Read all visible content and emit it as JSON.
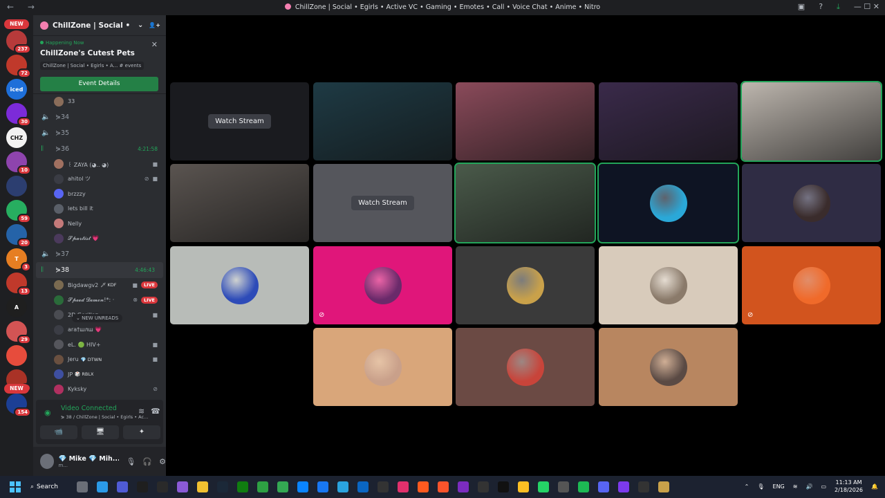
{
  "window": {
    "title": "ChillZone | Social • Egirls • Active VC • Gaming • Emotes • Call • Voice Chat • Anime • Nitro",
    "nav": "← →",
    "controls": "—  ☐  ✕"
  },
  "servers": {
    "new_top": "NEW",
    "new_bottom": "NEW",
    "items": [
      {
        "badge": "237",
        "color": "#b73a3a",
        "label": ""
      },
      {
        "badge": "72",
        "color": "#c0392b",
        "label": ""
      },
      {
        "badge": "",
        "color": "#1e6fd9",
        "label": "iced"
      },
      {
        "badge": "30",
        "color": "#7c2bd9",
        "label": ""
      },
      {
        "badge": "",
        "color": "#f2f2f2",
        "label": "CHZ"
      },
      {
        "badge": "10",
        "color": "#8e44ad",
        "label": ""
      },
      {
        "badge": "",
        "color": "#2c3e70",
        "label": ""
      },
      {
        "badge": "59",
        "color": "#27ae60",
        "label": ""
      },
      {
        "badge": "20",
        "color": "#2563a8",
        "label": ""
      },
      {
        "badge": "3",
        "color": "#e67e22",
        "label": "T"
      },
      {
        "badge": "13",
        "color": "#c0392b",
        "label": ""
      },
      {
        "badge": "",
        "color": "#1f1f1f",
        "label": "A"
      },
      {
        "badge": "29",
        "color": "#d35454",
        "label": ""
      },
      {
        "badge": "",
        "color": "#e74c3c",
        "label": ""
      },
      {
        "badge": "3",
        "color": "#a93226",
        "label": ""
      },
      {
        "badge": "154",
        "color": "#1c3f95",
        "label": ""
      }
    ]
  },
  "guild": {
    "name": "ChillZone | Social • Egi...",
    "chevron": "⌄",
    "invite_icon": "👤+"
  },
  "event": {
    "status": "Happening Now",
    "name": "ChillZone's Cutest Pets",
    "location": "ChillZone | Social • Egirls • A...  # events",
    "button": "Event Details",
    "close": "✕"
  },
  "channels": [
    {
      "kind": "member",
      "name": "33",
      "avatar": "#8a6d5a",
      "tags": [],
      "icons": []
    },
    {
      "kind": "voice",
      "name": "34",
      "active": false,
      "time": ""
    },
    {
      "kind": "voice",
      "name": "35",
      "active": false,
      "time": ""
    },
    {
      "kind": "voice",
      "name": "36",
      "active": false,
      "time": "4:21:58",
      "live_icon": true
    },
    {
      "kind": "member",
      "name": "꒰ ZAYA (◕.. ◕)",
      "avatar": "#a07060",
      "tags": [],
      "icons": [
        "cam"
      ]
    },
    {
      "kind": "member",
      "name": "ahitol ツ",
      "avatar": "#3a3c44",
      "tags": [],
      "icons": [
        "mute",
        "cam"
      ]
    },
    {
      "kind": "member",
      "name": "brzzzy",
      "avatar": "#5865f2",
      "tags": [],
      "icons": []
    },
    {
      "kind": "member",
      "name": "lets bill it",
      "avatar": "#5a5f68",
      "tags": [],
      "icons": []
    },
    {
      "kind": "member",
      "name": "Nelly",
      "avatar": "#c47a7a",
      "tags": [],
      "icons": []
    },
    {
      "kind": "member",
      "name": "𝓢𝓹𝓪𝓻𝓽𝓲𝓼𝓽 💗",
      "avatar": "#4b3a5c",
      "tags": [],
      "icons": []
    },
    {
      "kind": "voice",
      "name": "37",
      "active": false,
      "time": ""
    },
    {
      "kind": "voice",
      "name": "38",
      "active": true,
      "time": "4:46:43",
      "live_icon": true
    },
    {
      "kind": "member",
      "name": "Bigdawgv2",
      "avatar": "#7a6a50",
      "tags": [
        "🗡 KDF"
      ],
      "icons": [
        "cam",
        "live"
      ]
    },
    {
      "kind": "member",
      "name": "𝓢𝓹𝓮𝓮𝓭 𝓓𝓮𝓶𝓸𝓷!*: ·",
      "avatar": "#2a6b3a",
      "tags": [],
      "icons": [
        "xbox",
        "live"
      ]
    },
    {
      "kind": "member",
      "name": "2D Gorillaz",
      "avatar": "#4a4c52",
      "tags": [],
      "icons": [
        "cam"
      ]
    },
    {
      "kind": "member",
      "name": "ara†шлш 💗",
      "avatar": "#3b3d45",
      "tags": [],
      "icons": []
    },
    {
      "kind": "member",
      "name": "eL. 🟢 HIV+",
      "avatar": "#55565c",
      "tags": [],
      "icons": [
        "cam"
      ]
    },
    {
      "kind": "member",
      "name": "Jeru",
      "avatar": "#6a5040",
      "tags": [
        "💎 DTWN"
      ],
      "icons": [
        "cam"
      ]
    },
    {
      "kind": "member",
      "name": "JP",
      "avatar": "#3e4fa0",
      "tags": [
        "🎲 RBLX"
      ],
      "icons": []
    },
    {
      "kind": "member",
      "name": "Kyksky",
      "avatar": "#b03060",
      "tags": [],
      "icons": [
        "mute"
      ]
    }
  ],
  "new_unreads": "⌄ NEW UNREADS",
  "voice_connected": {
    "title": "Video Connected",
    "subtitle": "⋟ 38 / ChillZone | Social • Egirls • Ac...",
    "buttons": [
      "📹",
      "🖥",
      "✦"
    ]
  },
  "user": {
    "name": "💎 Mike 💎 Mih...",
    "status": "m..."
  },
  "tiles": [
    {
      "row": 0,
      "col": 0,
      "bg": "#1a1b1f",
      "watch": "Watch Stream",
      "avatar": "",
      "speaking": false,
      "muted": false
    },
    {
      "row": 0,
      "col": 1,
      "bg": "#1e3a44",
      "watch": "",
      "avatar": "",
      "speaking": false,
      "muted": false
    },
    {
      "row": 0,
      "col": 2,
      "bg": "#8a4a5a",
      "watch": "",
      "avatar": "",
      "speaking": false,
      "muted": false
    },
    {
      "row": 0,
      "col": 3,
      "bg": "#3a2a4a",
      "watch": "",
      "avatar": "",
      "speaking": false,
      "muted": false
    },
    {
      "row": 0,
      "col": 4,
      "bg": "#bdb6ae",
      "watch": "",
      "avatar": "",
      "speaking": true,
      "muted": false
    },
    {
      "row": 1,
      "col": 0,
      "bg": "#5a5450",
      "watch": "",
      "avatar": "",
      "speaking": false,
      "muted": false
    },
    {
      "row": 1,
      "col": 1,
      "bg": "#55565c",
      "watch": "Watch Stream",
      "avatar": "",
      "speaking": false,
      "muted": false
    },
    {
      "row": 1,
      "col": 2,
      "bg": "#4a5a4a",
      "watch": "",
      "avatar": "",
      "speaking": true,
      "muted": false
    },
    {
      "row": 1,
      "col": 3,
      "bg": "#0e1423",
      "watch": "",
      "avatar": "#2aa8d8",
      "speaking": true,
      "muted": false
    },
    {
      "row": 1,
      "col": 4,
      "bg": "#2f2c44",
      "watch": "",
      "avatar": "#3a2c2c",
      "speaking": false,
      "muted": false
    },
    {
      "row": 2,
      "col": 0,
      "bg": "#b8bcb8",
      "watch": "",
      "avatar": "#2d4bb8",
      "speaking": false,
      "muted": false
    },
    {
      "row": 2,
      "col": 1,
      "bg": "#e0167a",
      "watch": "",
      "avatar": "#6a2a6a",
      "speaking": false,
      "muted": true
    },
    {
      "row": 2,
      "col": 2,
      "bg": "#3a3a3a",
      "watch": "",
      "avatar": "#c9a14a",
      "speaking": false,
      "muted": false
    },
    {
      "row": 2,
      "col": 3,
      "bg": "#d8cbbb",
      "watch": "",
      "avatar": "#8a7a6a",
      "speaking": false,
      "muted": false
    },
    {
      "row": 2,
      "col": 4,
      "bg": "#d2541e",
      "watch": "",
      "avatar": "#f06a2a",
      "speaking": false,
      "muted": true
    },
    {
      "row": 3,
      "col": 1,
      "bg": "#d9a67a",
      "watch": "",
      "avatar": "#c9a08a",
      "speaking": false,
      "muted": false
    },
    {
      "row": 3,
      "col": 2,
      "bg": "#6b4a44",
      "watch": "",
      "avatar": "#c8443a",
      "speaking": false,
      "muted": false
    },
    {
      "row": 3,
      "col": 3,
      "bg": "#b88660",
      "watch": "",
      "avatar": "#5a4a44",
      "speaking": false,
      "muted": false
    }
  ],
  "taskbar": {
    "search_label": "Search",
    "app_colors": [
      "#6b6f78",
      "#2b9ae8",
      "#4f5bd5",
      "#1f1f1f",
      "#2a2a2a",
      "#8a5ad6",
      "#f0c030",
      "#1b2838",
      "#107c10",
      "#2ea043",
      "#34a853",
      "#0a84ff",
      "#1877f2",
      "#2aa3df",
      "#0a66c2",
      "#333",
      "#e1306c",
      "#ff5a1f",
      "#fb542b",
      "#7b2cbf",
      "#333",
      "#111",
      "#fbbf24",
      "#25d366",
      "#555",
      "#1db954",
      "#5865f2",
      "#7c3aed",
      "#333",
      "#c9a14a"
    ],
    "lang": "ENG",
    "time": "11:13 AM",
    "date": "2/18/2026"
  }
}
